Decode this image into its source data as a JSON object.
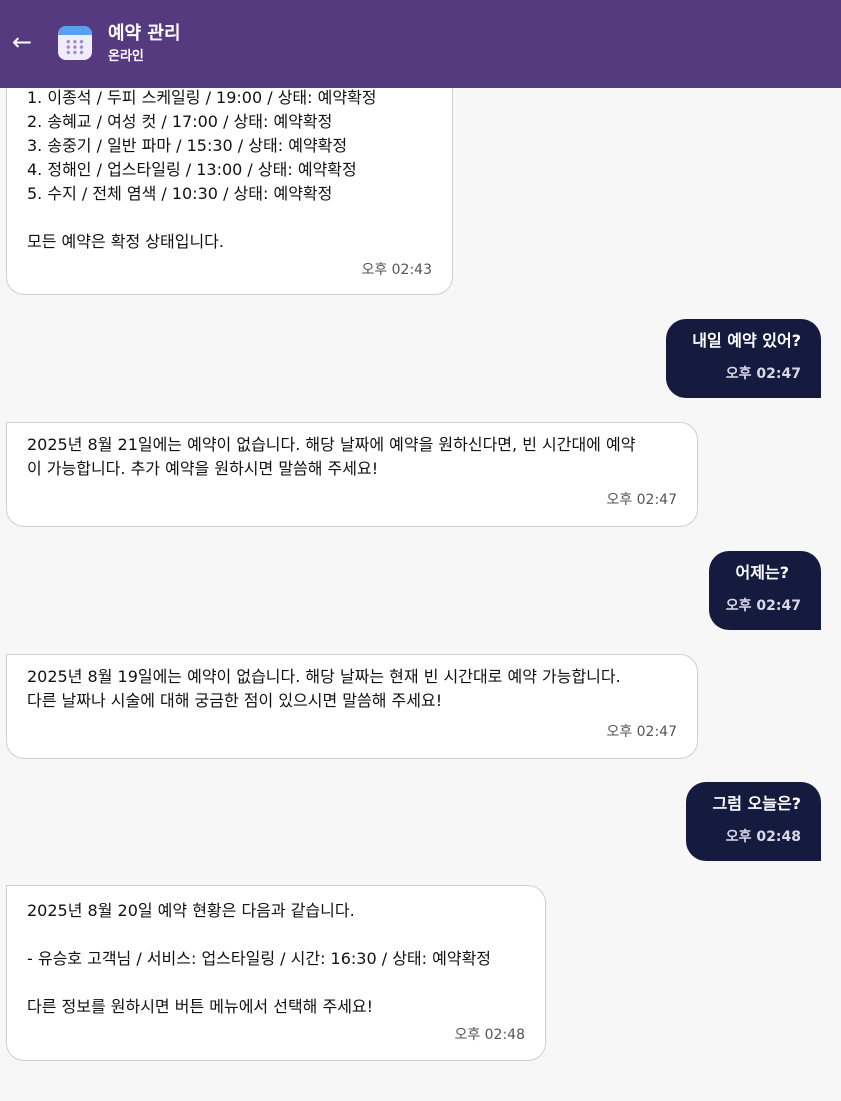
{
  "header": {
    "back_label": "←",
    "title": "예약 관리",
    "status": "온라인",
    "icon": "calendar-icon",
    "bg_color": "#563a7f"
  },
  "messages": [
    {
      "sender": "bot",
      "text": "1. 이종석 / 두피 스케일링 / 19:00 / 상태: 예약확정\n2. 송혜교 / 여성 컷 / 17:00 / 상태: 예약확정\n3. 송중기 / 일반 파마 / 15:30 / 상태: 예약확정\n4. 정해인 / 업스타일링 / 13:00 / 상태: 예약확정\n5. 수지 / 전체 염색 / 10:30 / 상태: 예약확정\n\n모든 예약은 확정 상태입니다.",
      "time": "오후 02:43"
    },
    {
      "sender": "user",
      "text": "내일 예약 있어?",
      "time": "오후 02:47"
    },
    {
      "sender": "bot",
      "text": "2025년 8월 21일에는 예약이 없습니다. 해당 날짜에 예약을 원하신다면, 빈 시간대에 예약\n이 가능합니다. 추가 예약을 원하시면 말씀해 주세요!",
      "time": "오후 02:47"
    },
    {
      "sender": "user",
      "text": "어제는?",
      "time": "오후 02:47"
    },
    {
      "sender": "bot",
      "text": "2025년 8월 19일에는 예약이 없습니다. 해당 날짜는 현재 빈 시간대로 예약 가능합니다.\n다른 날짜나 시술에 대해 궁금한 점이 있으시면 말씀해 주세요!",
      "time": "오후 02:47"
    },
    {
      "sender": "user",
      "text": "그럼 오늘은?",
      "time": "오후 02:48"
    },
    {
      "sender": "bot",
      "text": "2025년 8월 20일 예약 현황은 다음과 같습니다.\n\n- 유승호 고객님 / 서비스: 업스타일링 / 시간: 16:30 / 상태: 예약확정\n\n다른 정보를 원하시면 버튼 메뉴에서 선택해 주세요!",
      "time": "오후 02:48"
    }
  ],
  "colors": {
    "user_bubble": "#151b3f",
    "bot_bubble": "#ffffff",
    "background": "#f7f7f7"
  }
}
